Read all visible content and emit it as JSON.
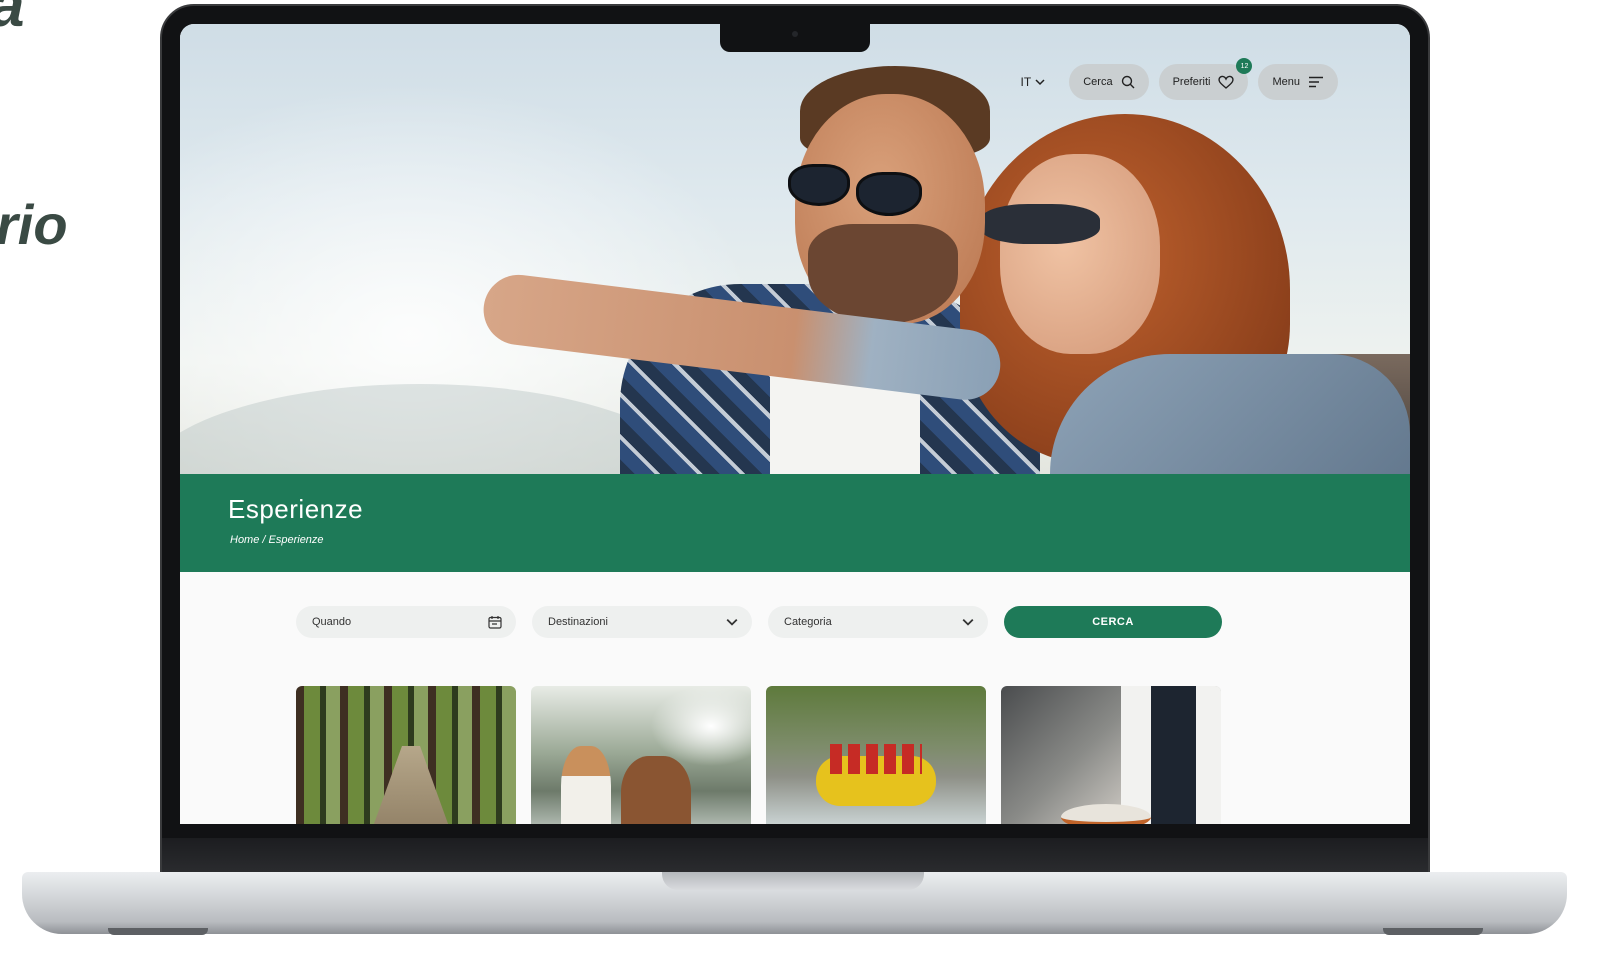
{
  "slide": {
    "text_top": "a",
    "text_mid": "rio"
  },
  "nav": {
    "language": "IT",
    "search_label": "Cerca",
    "favorites_label": "Preferiti",
    "favorites_count": "12",
    "menu_label": "Menu"
  },
  "band": {
    "title": "Esperienze",
    "breadcrumb": "Home / Esperienze"
  },
  "search": {
    "when_label": "Quando",
    "destinations_label": "Destinazioni",
    "category_label": "Categoria",
    "submit_label": "CERCA"
  },
  "cards": [
    {
      "subject": "forest-hiking"
    },
    {
      "subject": "girl-with-horse"
    },
    {
      "subject": "river-rafting"
    },
    {
      "subject": "chef-cooking"
    }
  ],
  "colors": {
    "brand_green": "#1e7a58",
    "pill_grey": "#c8cbcd",
    "field_bg": "#eef0ef"
  },
  "icons": [
    "chevron-down-icon",
    "search-icon",
    "heart-icon",
    "menu-icon",
    "calendar-icon"
  ]
}
